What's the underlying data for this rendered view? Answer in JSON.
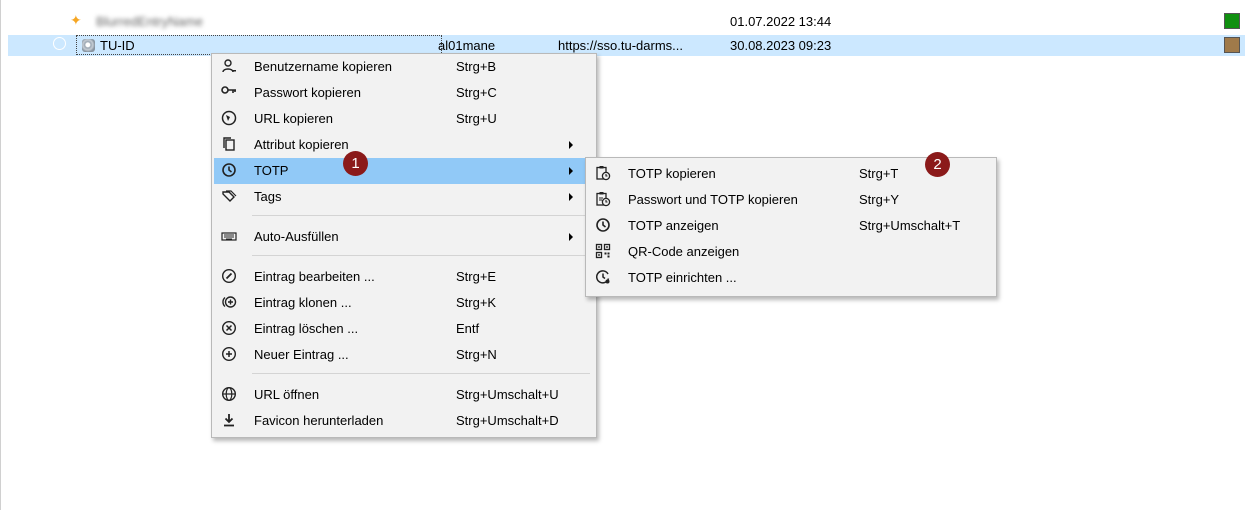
{
  "entries": [
    {
      "title": "BlurredEntryName",
      "username": "",
      "url": "",
      "modified": "01.07.2022 13:44",
      "color": "#109010"
    },
    {
      "title": "TU-ID",
      "username": "al01mane",
      "url": "https://sso.tu-darms...",
      "modified": "30.08.2023 09:23",
      "color": "#a07a4a"
    }
  ],
  "context_menu": {
    "items": [
      {
        "label": "Benutzername kopieren",
        "shortcut": "Strg+B",
        "icon": "user-icon"
      },
      {
        "label": "Passwort kopieren",
        "shortcut": "Strg+C",
        "icon": "key-icon"
      },
      {
        "label": "URL kopieren",
        "shortcut": "Strg+U",
        "icon": "globe-link-icon"
      },
      {
        "label": "Attribut kopieren",
        "shortcut": "",
        "icon": "copy-icon"
      },
      {
        "label": "TOTP",
        "shortcut": "",
        "icon": "clock-icon"
      },
      {
        "label": "Tags",
        "shortcut": "",
        "icon": "tag-icon"
      },
      {
        "label": "Auto-Ausfüllen",
        "shortcut": "",
        "icon": "keyboard-icon"
      },
      {
        "label": "Eintrag bearbeiten ...",
        "shortcut": "Strg+E",
        "icon": "edit-icon"
      },
      {
        "label": "Eintrag klonen ...",
        "shortcut": "Strg+K",
        "icon": "clone-icon"
      },
      {
        "label": "Eintrag löschen ...",
        "shortcut": "Entf",
        "icon": "delete-icon"
      },
      {
        "label": "Neuer Eintrag ...",
        "shortcut": "Strg+N",
        "icon": "add-icon"
      },
      {
        "label": "URL öffnen",
        "shortcut": "Strg+Umschalt+U",
        "icon": "globe-icon"
      },
      {
        "label": "Favicon herunterladen",
        "shortcut": "Strg+Umschalt+D",
        "icon": "download-icon"
      }
    ]
  },
  "totp_submenu": {
    "items": [
      {
        "label": "TOTP kopieren",
        "shortcut": "Strg+T",
        "icon": "clipboard-clock-icon"
      },
      {
        "label": "Passwort und TOTP kopieren",
        "shortcut": "Strg+Y",
        "icon": "clipboard-clock-icon"
      },
      {
        "label": "TOTP anzeigen",
        "shortcut": "Strg+Umschalt+T",
        "icon": "clock-icon"
      },
      {
        "label": "QR-Code anzeigen",
        "shortcut": "",
        "icon": "qr-code-icon"
      },
      {
        "label": "TOTP einrichten ...",
        "shortcut": "",
        "icon": "clock-settings-icon"
      }
    ]
  },
  "annotations": [
    "1",
    "2"
  ],
  "colors": {
    "selection": "#cce8ff",
    "menu_highlight": "#91c9f7",
    "badge": "#8b1a1a"
  }
}
